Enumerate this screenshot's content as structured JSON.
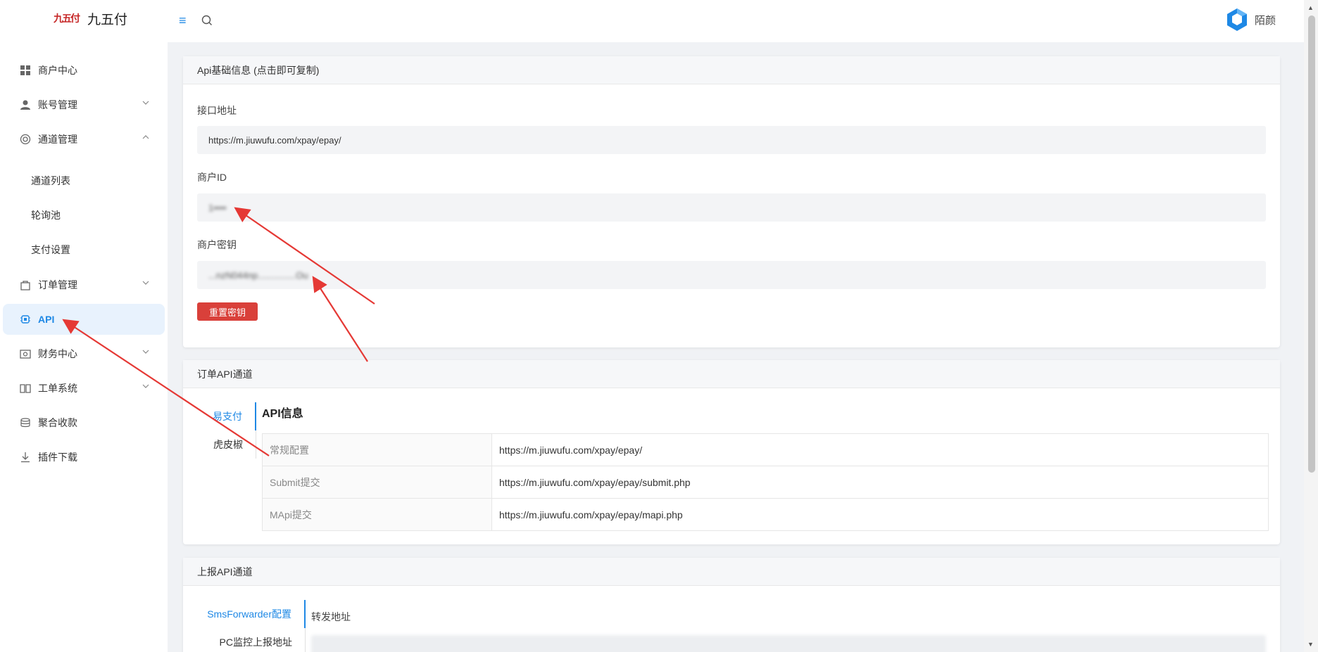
{
  "brand": {
    "logo_glyph": "九五付",
    "name": "九五付"
  },
  "topbar": {
    "menu_icon": "menu-icon",
    "search_icon": "search-icon"
  },
  "user": {
    "name": "陌颜",
    "avatar_icon": "hexagon-logo-icon"
  },
  "sidebar": {
    "items": [
      {
        "label": "商户中心",
        "icon": "grid-icon"
      },
      {
        "label": "账号管理",
        "icon": "user-icon"
      },
      {
        "label": "通道管理",
        "icon": "ring-icon"
      },
      {
        "label": "订单管理",
        "icon": "bag-icon"
      },
      {
        "label": "API",
        "icon": "chip-icon"
      },
      {
        "label": "财务中心",
        "icon": "finance-icon"
      },
      {
        "label": "工单系统",
        "icon": "book-icon"
      },
      {
        "label": "聚合收款",
        "icon": "coin-stack-icon"
      },
      {
        "label": "插件下载",
        "icon": "download-icon"
      }
    ],
    "sub_items": [
      "通道列表",
      "轮询池",
      "支付设置"
    ]
  },
  "basic": {
    "header": "Api基础信息 (点击即可复制)",
    "endpoint_label": "接口地址",
    "endpoint_value": "https://m.jiuwufu.com/xpay/epay/",
    "merchant_id_label": "商户ID",
    "merchant_id_value": "1••••",
    "secret_label": "商户密钥",
    "secret_value": "...nzN044np...............Ou",
    "reset_button": "重置密钥"
  },
  "order_api": {
    "header": "订单API通道",
    "tabs": [
      "易支付",
      "虎皮椒"
    ],
    "title": "API信息",
    "rows": [
      {
        "key": "常规配置",
        "value": "https://m.jiuwufu.com/xpay/epay/"
      },
      {
        "key": "Submit提交",
        "value": "https://m.jiuwufu.com/xpay/epay/submit.php"
      },
      {
        "key": "MApi提交",
        "value": "https://m.jiuwufu.com/xpay/epay/mapi.php"
      }
    ]
  },
  "report_api": {
    "header": "上报API通道",
    "tabs": [
      "SmsForwarder配置",
      "PC监控上报地址"
    ],
    "forward_label": "转发地址"
  },
  "colors": {
    "accent": "#1e88e5",
    "danger": "#d9403a",
    "annotation_arrow": "#e53935"
  }
}
